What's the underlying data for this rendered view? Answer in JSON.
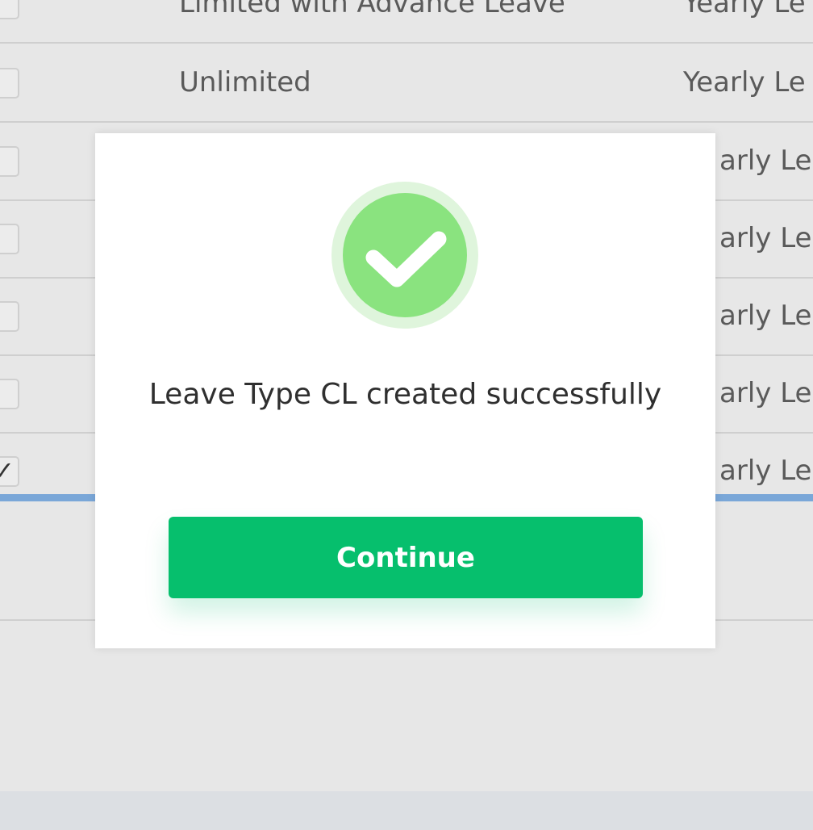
{
  "table": {
    "rows": [
      {
        "name": "Limited with Advance Leave",
        "type": "Yearly Le",
        "checked": false
      },
      {
        "name": "Unlimited",
        "type": "Yearly Le",
        "checked": false
      },
      {
        "name": "",
        "type": "arly Le",
        "checked": false
      },
      {
        "name": "",
        "type": "arly Le",
        "checked": false
      },
      {
        "name": "",
        "type": "arly Le",
        "checked": false
      },
      {
        "name": "",
        "type": "arly Le",
        "checked": false
      },
      {
        "name": "",
        "type": "arly Le",
        "checked": true
      }
    ]
  },
  "modal": {
    "icon": "check-circle-icon",
    "message": "Leave Type CL created successfully",
    "continue_label": "Continue"
  },
  "colors": {
    "accent_green": "#06bf6d",
    "icon_green": "#8ae37f",
    "selected_blue": "#7aa7d8"
  }
}
